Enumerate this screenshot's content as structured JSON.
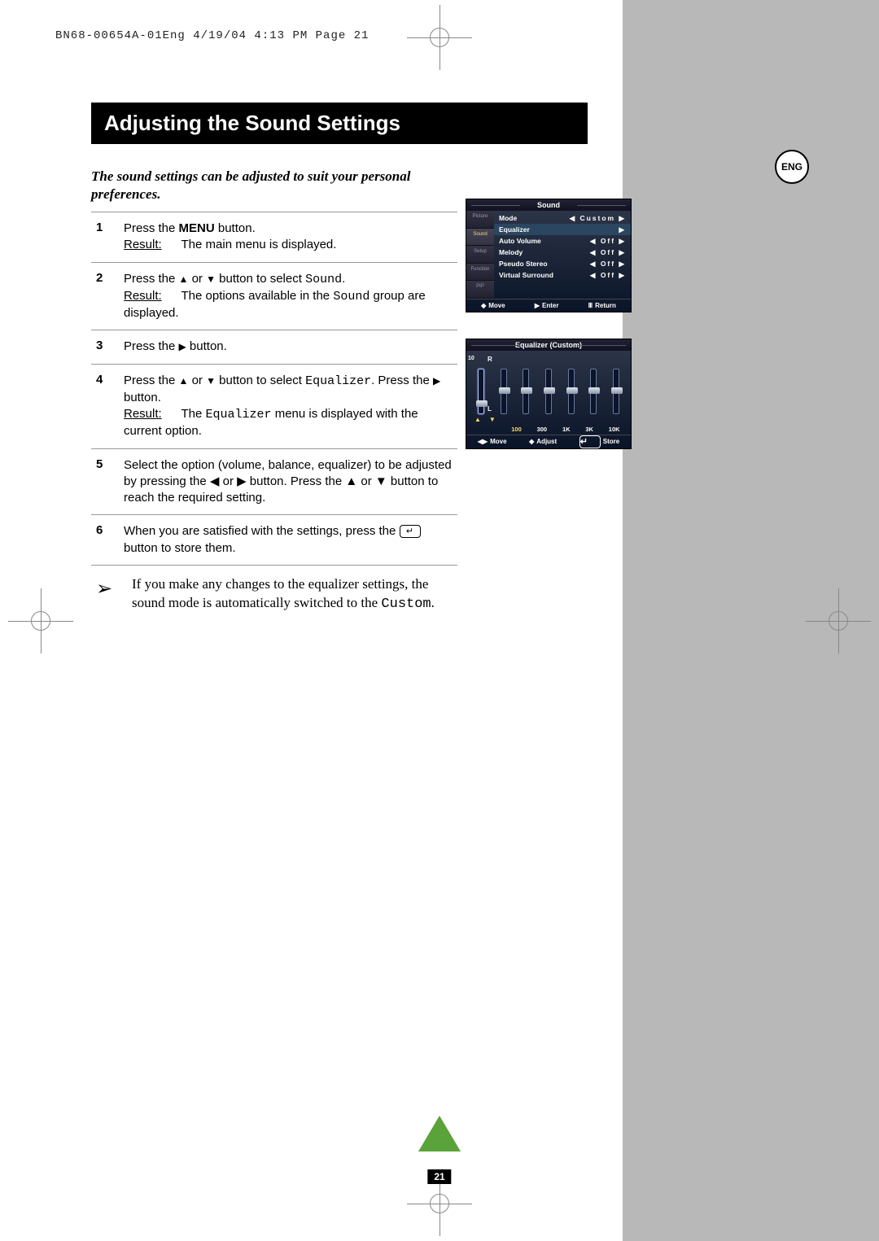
{
  "header_line": "BN68-00654A-01Eng  4/19/04  4:13 PM  Page 21",
  "title": "Adjusting the Sound Settings",
  "lang_badge": "ENG",
  "intro": "The sound settings can be adjusted to suit your personal preferences.",
  "result_label": "Result:",
  "steps": {
    "s1": {
      "num": "1",
      "line1_a": "Press the ",
      "line1_bold": "MENU",
      "line1_b": " button.",
      "result": "The main menu is displayed."
    },
    "s2": {
      "num": "2",
      "line1_a": "Press the ",
      "line1_b": " or ",
      "line1_c": " button to select ",
      "mono": "Sound",
      "line1_d": ".",
      "result_a": "The options available in the ",
      "result_mono": "Sound",
      "result_b": " group are displayed."
    },
    "s3": {
      "num": "3",
      "line1_a": "Press the ",
      "line1_b": " button."
    },
    "s4": {
      "num": "4",
      "line1_a": "Press the ",
      "line1_b": " or ",
      "line1_c": " button to select ",
      "mono": "Equalizer",
      "line1_d": ". Press the ",
      "line1_e": " button.",
      "result_a": "The ",
      "result_mono": "Equalizer",
      "result_b": " menu is displayed with the current option."
    },
    "s5": {
      "num": "5",
      "text": "Select the option (volume, balance, equalizer) to be adjusted by pressing the ◀ or ▶ button. Press the ▲ or ▼ button to reach the required setting."
    },
    "s6": {
      "num": "6",
      "text_a": "When you are satisfied with the settings, press the ",
      "text_b": " button to store them."
    }
  },
  "note": {
    "text_a": "If you make any changes to the equalizer settings, the sound mode is automatically switched to the ",
    "mono": "Custom",
    "text_b": "."
  },
  "osd_sound": {
    "header": "Sound",
    "tabs": [
      "Picture",
      "Sound",
      "Setup",
      "Function",
      "PIP"
    ],
    "items": [
      {
        "label": "Mode",
        "value": "◀  Custom  ▶"
      },
      {
        "label": "Equalizer",
        "value": "▶",
        "hl": true
      },
      {
        "label": "Auto Volume",
        "value": "◀  Off  ▶"
      },
      {
        "label": "Melody",
        "value": "◀  Off  ▶"
      },
      {
        "label": "Pseudo Stereo",
        "value": "◀  Off  ▶"
      },
      {
        "label": "Virtual Surround",
        "value": "◀  Off  ▶"
      }
    ],
    "footer": {
      "move": "Move",
      "enter": "Enter",
      "return": "Return"
    }
  },
  "osd_eq": {
    "header": "Equalizer (Custom)",
    "scale_top": "10",
    "r": "R",
    "l": "L",
    "bands": [
      "100",
      "300",
      "1K",
      "3K",
      "10K"
    ],
    "footer": {
      "move": "Move",
      "adjust": "Adjust",
      "store": "Store"
    }
  },
  "page_number": "21",
  "glyphs": {
    "up": "▲",
    "down": "▼",
    "left": "◀",
    "right": "▶",
    "enter": "↵",
    "updown": "◆",
    "leftright": "◀▶",
    "menu": "Ⅲ"
  }
}
